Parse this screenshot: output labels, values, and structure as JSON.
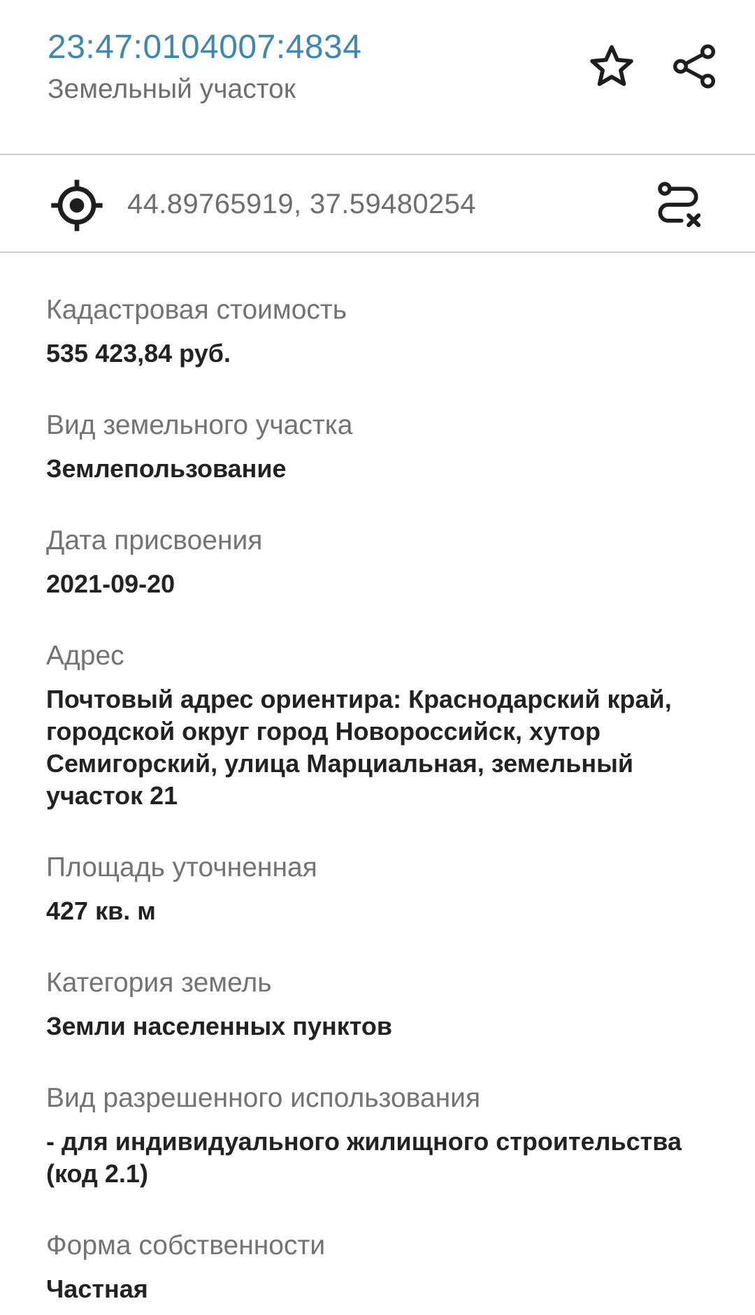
{
  "header": {
    "cadastral_number": "23:47:0104007:4834",
    "object_type": "Земельный участок",
    "favorite_icon": "star-outline-icon",
    "share_icon": "share-icon"
  },
  "location": {
    "icon": "target-icon",
    "coordinates": "44.89765919, 37.59480254",
    "route_icon": "route-cancel-icon"
  },
  "fields": [
    {
      "label": "Кадастровая стоимость",
      "value": "535 423,84 руб."
    },
    {
      "label": "Вид земельного участка",
      "value": "Землепользование"
    },
    {
      "label": "Дата присвоения",
      "value": "2021-09-20"
    },
    {
      "label": "Адрес",
      "value": "Почтовый адрес ориентира: Краснодарский край, городской округ город Новороссийск, хутор Семигорский, улица Марциальная, земельный участок 21"
    },
    {
      "label": "Площадь уточненная",
      "value": "427 кв. м"
    },
    {
      "label": "Категория земель",
      "value": "Земли населенных пунктов"
    },
    {
      "label": "Вид разрешенного использования",
      "value": "- для индивидуального жилищного строительства (код 2.1)"
    },
    {
      "label": "Форма собственности",
      "value": "Частная"
    }
  ],
  "colors": {
    "accent": "#3d87b3",
    "label": "#737373",
    "value": "#222222",
    "divider": "#cfcfcf"
  }
}
